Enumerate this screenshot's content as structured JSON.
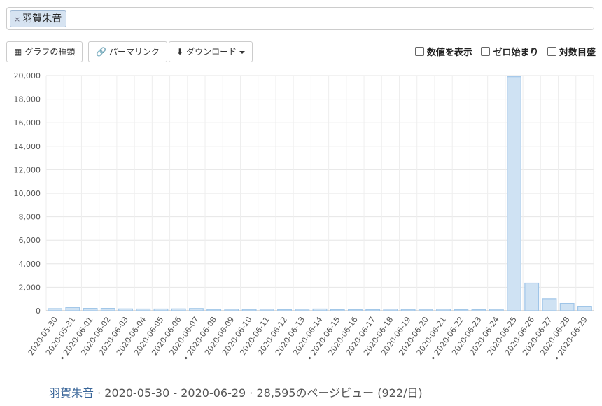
{
  "search": {
    "tag_label": "羽賀朱音",
    "remove_glyph": "×"
  },
  "toolbar": {
    "chart_type_label": "グラフの種類",
    "permalink_label": "パーマリンク",
    "download_label": "ダウンロード"
  },
  "options": {
    "show_values_label": "数値を表示",
    "zero_start_label": "ゼロ始まり",
    "log_scale_label": "対数目盛"
  },
  "chart_data": {
    "type": "bar",
    "categories": [
      "2020-05-30",
      "2020-05-31",
      "2020-06-01",
      "2020-06-02",
      "2020-06-03",
      "2020-06-04",
      "2020-06-05",
      "2020-06-06",
      "2020-06-07",
      "2020-06-08",
      "2020-06-09",
      "2020-06-10",
      "2020-06-11",
      "2020-06-12",
      "2020-06-13",
      "2020-06-14",
      "2020-06-15",
      "2020-06-16",
      "2020-06-17",
      "2020-06-18",
      "2020-06-19",
      "2020-06-20",
      "2020-06-21",
      "2020-06-22",
      "2020-06-23",
      "2020-06-24",
      "2020-06-25",
      "2020-06-26",
      "2020-06-27",
      "2020-06-28",
      "2020-06-29"
    ],
    "values": [
      180,
      280,
      200,
      200,
      160,
      150,
      150,
      160,
      190,
      110,
      130,
      110,
      140,
      100,
      130,
      150,
      100,
      100,
      100,
      140,
      110,
      120,
      130,
      100,
      100,
      120,
      19900,
      2350,
      1020,
      620,
      380
    ],
    "ylim": [
      0,
      20000
    ],
    "yticks": [
      0,
      2000,
      4000,
      6000,
      8000,
      10000,
      12000,
      14000,
      16000,
      18000,
      20000
    ],
    "ytick_labels": [
      "0",
      "2,000",
      "4,000",
      "6,000",
      "8,000",
      "10,000",
      "12,000",
      "14,000",
      "16,000",
      "18,000",
      "20,000"
    ],
    "weekend_marked": [
      "2020-06-01",
      "2020-06-08",
      "2020-06-15",
      "2020-06-22",
      "2020-06-29"
    ],
    "bar_fill": "#cfe2f3",
    "bar_stroke": "#9fc5e8",
    "grid": true
  },
  "footer": {
    "article": "羽賀朱音",
    "sep1": " · ",
    "start_date": "2020-05-30",
    "dash": " - ",
    "end_date": "2020-06-29",
    "sep2": " · ",
    "summary": "28,595のページビュー (922/日)"
  }
}
